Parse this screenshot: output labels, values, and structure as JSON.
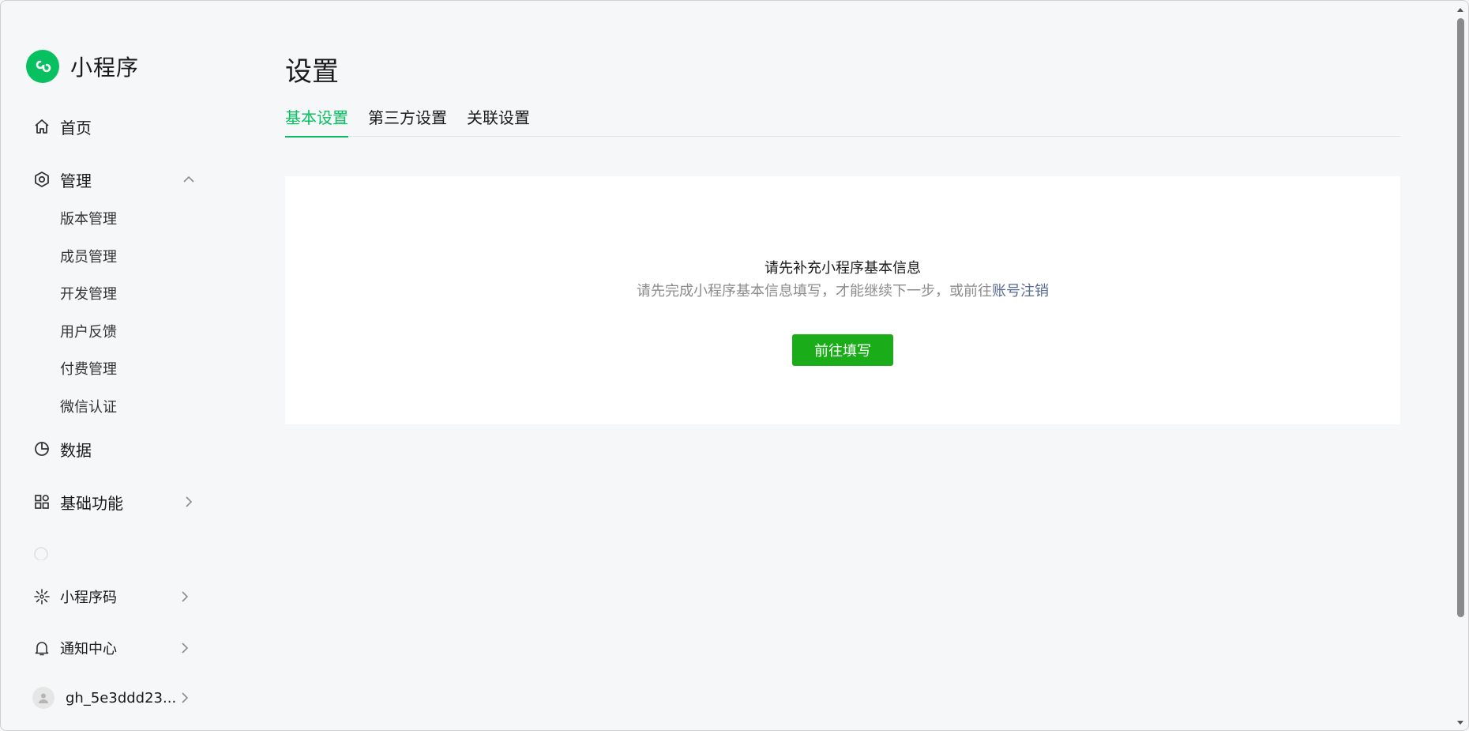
{
  "app": {
    "brand_name": "小程序",
    "brand_color": "#07c160"
  },
  "sidebar": {
    "home": {
      "label": "首页",
      "icon": "home-icon"
    },
    "manage": {
      "label": "管理",
      "icon": "settings-hexagon-icon",
      "expanded": true,
      "children": [
        {
          "label": "版本管理"
        },
        {
          "label": "成员管理"
        },
        {
          "label": "开发管理"
        },
        {
          "label": "用户反馈"
        },
        {
          "label": "付费管理"
        },
        {
          "label": "微信认证"
        }
      ]
    },
    "data": {
      "label": "数据",
      "icon": "pie-chart-icon"
    },
    "basic_functions": {
      "label": "基础功能",
      "icon": "apps-grid-icon"
    },
    "mini_program_code": {
      "label": "小程序码",
      "icon": "sparkle-code-icon"
    },
    "notification_center": {
      "label": "通知中心",
      "icon": "bell-icon"
    },
    "account": {
      "label": "gh_5e3ddd23...",
      "icon": "avatar-icon"
    }
  },
  "main": {
    "page_title": "设置",
    "tabs": [
      {
        "label": "基本设置",
        "active": true
      },
      {
        "label": "第三方设置",
        "active": false
      },
      {
        "label": "关联设置",
        "active": false
      }
    ],
    "notice": {
      "title": "请先补充小程序基本信息",
      "desc_prefix": "请先完成小程序基本信息填写，才能继续下一步，或前往",
      "desc_link": "账号注销",
      "button_label": "前往填写",
      "button_color": "#1aad19",
      "link_color": "#576b95"
    }
  }
}
